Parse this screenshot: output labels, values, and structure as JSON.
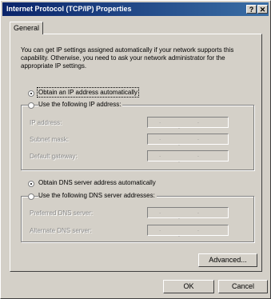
{
  "window": {
    "title": "Internet Protocol (TCP/IP) Properties",
    "help_label": "?",
    "close_label": "✕"
  },
  "tabs": [
    {
      "label": "General"
    }
  ],
  "intro_text": "You can get IP settings assigned automatically if your network supports this capability. Otherwise, you need to ask your network administrator for the appropriate IP settings.",
  "ip": {
    "auto_label": "Obtain an IP address automatically",
    "manual_label": "Use the following IP address:",
    "selected": "auto",
    "fields": [
      {
        "label": "IP address:",
        "value": ". . ."
      },
      {
        "label": "Subnet mask:",
        "value": ". . ."
      },
      {
        "label": "Default gateway:",
        "value": ". . ."
      }
    ]
  },
  "dns": {
    "auto_label": "Obtain DNS server address automatically",
    "manual_label": "Use the following DNS server addresses:",
    "selected": "auto",
    "fields": [
      {
        "label": "Preferred DNS server:",
        "value": ". . ."
      },
      {
        "label": "Alternate DNS server:",
        "value": ". . ."
      }
    ]
  },
  "buttons": {
    "advanced": "Advanced...",
    "ok": "OK",
    "cancel": "Cancel"
  }
}
